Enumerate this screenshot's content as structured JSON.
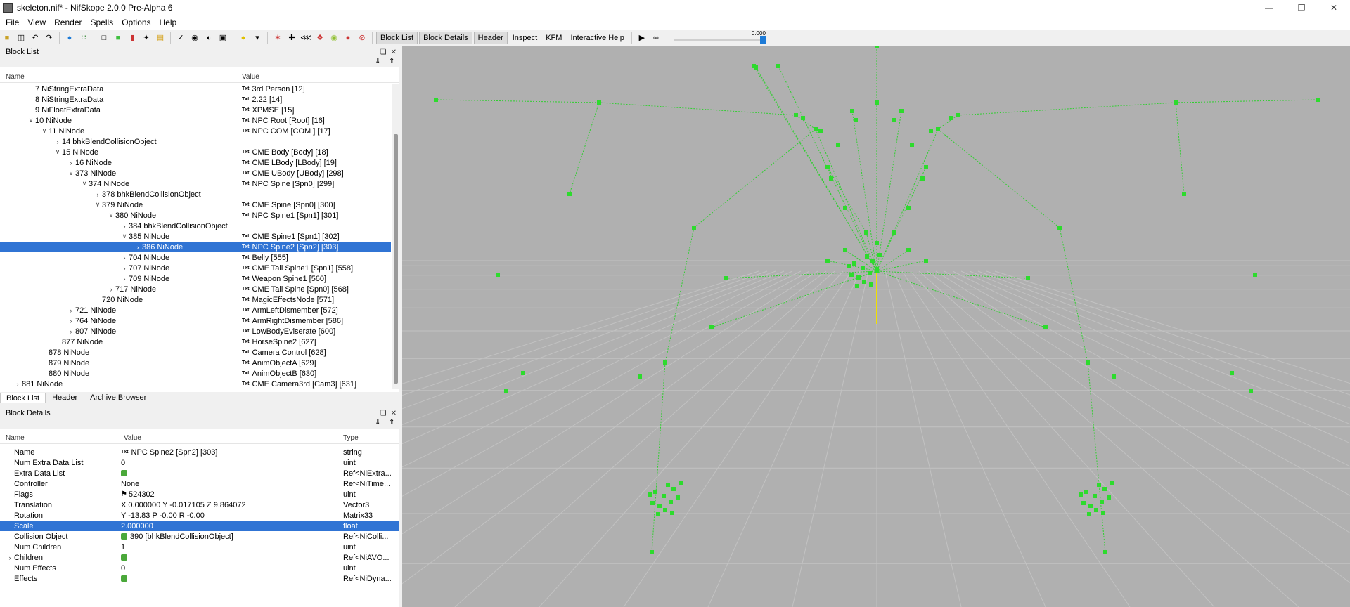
{
  "window": {
    "title": "skeleton.nif* - NifSkope 2.0.0 Pre-Alpha 6"
  },
  "menu": [
    "File",
    "View",
    "Render",
    "Spells",
    "Options",
    "Help"
  ],
  "toolbar": {
    "tabs": [
      "Block List",
      "Block Details",
      "Header",
      "Inspect",
      "KFM",
      "Interactive Help"
    ],
    "slider_value": "0.000"
  },
  "block_list": {
    "title": "Block List",
    "columns": {
      "name": "Name",
      "value": "Value"
    },
    "rows": [
      {
        "name": "7 NiStringExtraData",
        "value": "3rd Person [12]"
      },
      {
        "name": "8 NiStringExtraData",
        "value": "2.22 [14]"
      },
      {
        "name": "9 NiFloatExtraData",
        "value": "XPMSE [15]"
      },
      {
        "name": "10 NiNode",
        "value": "NPC Root [Root] [16]"
      },
      {
        "name": "11 NiNode",
        "value": "NPC COM [COM ] [17]"
      },
      {
        "name": "14 bhkBlendCollisionObject",
        "value": ""
      },
      {
        "name": "15 NiNode",
        "value": "CME Body [Body] [18]"
      },
      {
        "name": "16 NiNode",
        "value": "CME LBody [LBody] [19]"
      },
      {
        "name": "373 NiNode",
        "value": "CME UBody [UBody] [298]"
      },
      {
        "name": "374 NiNode",
        "value": "NPC Spine [Spn0] [299]"
      },
      {
        "name": "378 bhkBlendCollisionObject",
        "value": ""
      },
      {
        "name": "379 NiNode",
        "value": "CME Spine [Spn0] [300]"
      },
      {
        "name": "380 NiNode",
        "value": "NPC Spine1 [Spn1] [301]"
      },
      {
        "name": "384 bhkBlendCollisionObject",
        "value": ""
      },
      {
        "name": "385 NiNode",
        "value": "CME Spine1 [Spn1] [302]"
      },
      {
        "name": "386 NiNode",
        "value": "NPC Spine2 [Spn2] [303]"
      },
      {
        "name": "704 NiNode",
        "value": "Belly [555]"
      },
      {
        "name": "707 NiNode",
        "value": "CME Tail Spine1 [Spn1] [558]"
      },
      {
        "name": "709 NiNode",
        "value": "Weapon Spine1 [560]"
      },
      {
        "name": "717 NiNode",
        "value": "CME Tail Spine [Spn0] [568]"
      },
      {
        "name": "720 NiNode",
        "value": "MagicEffectsNode [571]"
      },
      {
        "name": "721 NiNode",
        "value": "ArmLeftDismember [572]"
      },
      {
        "name": "764 NiNode",
        "value": "ArmRightDismember [586]"
      },
      {
        "name": "807 NiNode",
        "value": "LowBodyEviserate [600]"
      },
      {
        "name": "877 NiNode",
        "value": "HorseSpine2 [627]"
      },
      {
        "name": "878 NiNode",
        "value": "Camera Control [628]"
      },
      {
        "name": "879 NiNode",
        "value": "AnimObjectA [629]"
      },
      {
        "name": "880 NiNode",
        "value": "AnimObjectB [630]"
      },
      {
        "name": "881 NiNode",
        "value": "CME Camera3rd [Cam3] [631]"
      }
    ]
  },
  "bottom_tabs": [
    "Block List",
    "Header",
    "Archive Browser"
  ],
  "block_details": {
    "title": "Block Details",
    "columns": {
      "name": "Name",
      "value": "Value",
      "type": "Type"
    },
    "rows": [
      {
        "name": "Name",
        "value": "NPC Spine2 [Spn2] [303]",
        "type": "string"
      },
      {
        "name": "Num Extra Data List",
        "value": "0",
        "type": "uint"
      },
      {
        "name": "Extra Data List",
        "value": "",
        "type": "Ref<NiExtra..."
      },
      {
        "name": "Controller",
        "value": "None",
        "type": "Ref<NiTime..."
      },
      {
        "name": "Flags",
        "value": "524302",
        "type": "uint"
      },
      {
        "name": "Translation",
        "value": "X 0.000000 Y -0.017105 Z 9.864072",
        "type": "Vector3"
      },
      {
        "name": "Rotation",
        "value": "Y -13.83 P -0.00 R -0.00",
        "type": "Matrix33"
      },
      {
        "name": "Scale",
        "value": "2.000000",
        "type": "float"
      },
      {
        "name": "Collision Object",
        "value": "390 [bhkBlendCollisionObject]",
        "type": "Ref<NiColli..."
      },
      {
        "name": "Num Children",
        "value": "1",
        "type": "uint"
      },
      {
        "name": "Children",
        "value": "",
        "type": "Ref<NiAVO..."
      },
      {
        "name": "Num Effects",
        "value": "0",
        "type": "uint"
      },
      {
        "name": "Effects",
        "value": "",
        "type": "Ref<NiDyna..."
      }
    ]
  }
}
